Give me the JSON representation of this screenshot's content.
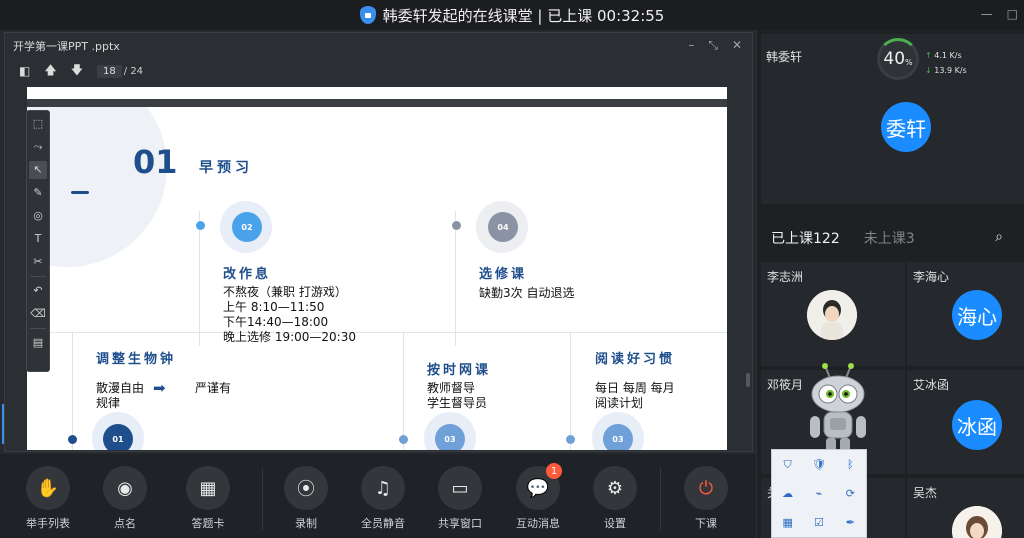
{
  "window": {
    "title": "韩委轩发起的在线课堂 | 已上课 00:32:55"
  },
  "doc": {
    "filename": "开学第一课PPT .pptx",
    "page": "18",
    "page_total": "/ 24"
  },
  "slide": {
    "number": "01",
    "title": "早预习",
    "circles": [
      "02",
      "04",
      "01",
      "03",
      "03"
    ],
    "sections": [
      {
        "heading": "改作息",
        "body": "不熬夜（兼职 打游戏）\n上午 8:10—11:50\n下午14:40—18:00\n晚上选修 19:00—20:30"
      },
      {
        "heading": "选修课",
        "body": "缺勤3次 自动退选"
      },
      {
        "heading": "调整生物钟",
        "body_left": "散漫自由\n规律",
        "body_right": "严谨有"
      },
      {
        "heading": "按时网课",
        "body": "教师督导\n学生督导员"
      },
      {
        "heading": "阅读好习惯",
        "body": "每日 每周 每月\n阅读计划"
      }
    ]
  },
  "bottom_tools": [
    {
      "label": "举手列表",
      "icon": "hand-icon"
    },
    {
      "label": "点名",
      "icon": "roll-call-icon"
    },
    {
      "label": "答题卡",
      "icon": "answer-card-icon"
    },
    {
      "label": "录制",
      "icon": "record-icon"
    },
    {
      "label": "全员静音",
      "icon": "mute-all-icon"
    },
    {
      "label": "共享窗口",
      "icon": "share-window-icon"
    },
    {
      "label": "互动消息",
      "icon": "chat-icon",
      "badge": "1"
    },
    {
      "label": "设置",
      "icon": "gear-icon"
    },
    {
      "label": "下课",
      "icon": "power-icon"
    }
  ],
  "teacher": {
    "name": "韩委轩",
    "avatar_text": "委轩",
    "network_quality": "40",
    "network_unit": "%",
    "upload": "4.1",
    "upload_unit": "K/s",
    "download": "13.9",
    "download_unit": "K/s"
  },
  "tabs": {
    "in_class": "已上课122",
    "not_in_class": "未上课3"
  },
  "students": [
    {
      "name": "李志洲",
      "avatar_text": ""
    },
    {
      "name": "李海心",
      "avatar_text": "海心"
    },
    {
      "name": "邓筱月",
      "avatar_text": ""
    },
    {
      "name": "艾冰函",
      "avatar_text": "冰函"
    },
    {
      "name": "关",
      "avatar_text": ""
    },
    {
      "name": "吴杰",
      "avatar_text": ""
    }
  ],
  "colors": {
    "accent": "#1a8cff",
    "slide_blue": "#1f4e8c",
    "end_red": "#ff5a3c",
    "badge_red": "#ff5a3c"
  }
}
